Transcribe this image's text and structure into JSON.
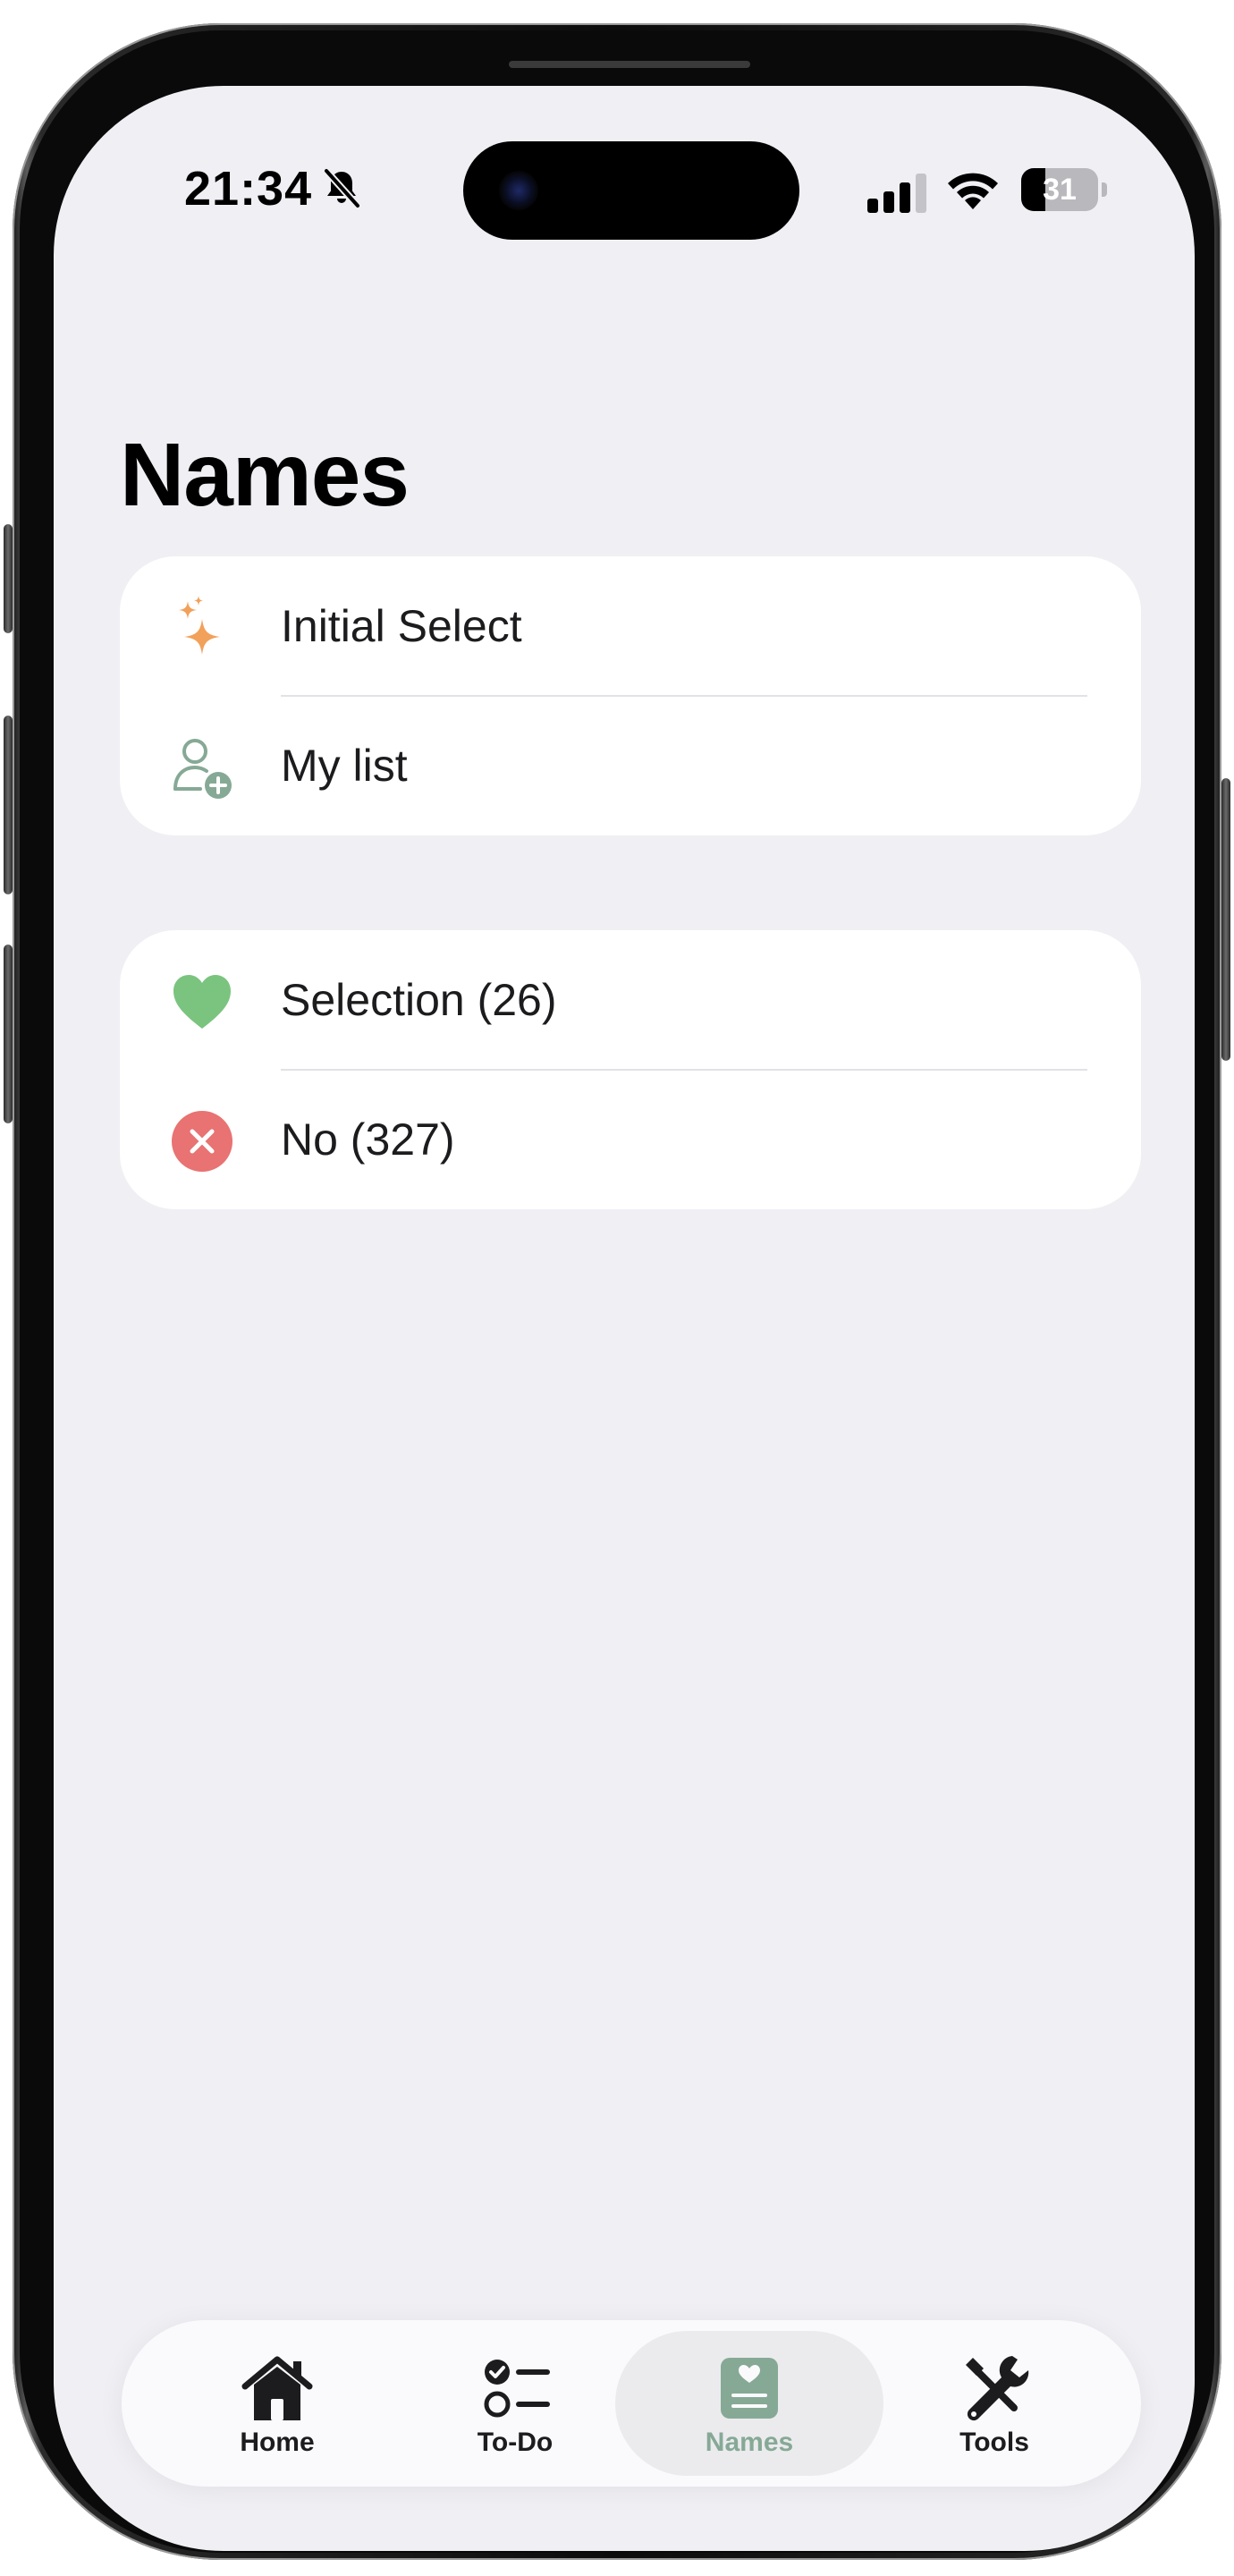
{
  "status_bar": {
    "time": "21:34",
    "battery_level": "31",
    "battery_fraction": 0.31
  },
  "page": {
    "title": "Names"
  },
  "groups": [
    {
      "items": [
        {
          "label": "Initial Select",
          "icon": "sparkles-icon",
          "icon_color": "#f2a15a"
        },
        {
          "label": "My list",
          "icon": "person-add-icon",
          "icon_color": "#86a996"
        }
      ]
    },
    {
      "items": [
        {
          "label": "Selection (26)",
          "icon": "heart-icon",
          "icon_color": "#7bc47f"
        },
        {
          "label": "No (327)",
          "icon": "close-circle-icon",
          "icon_color": "#e97272"
        }
      ]
    }
  ],
  "tabbar": {
    "tabs": [
      {
        "label": "Home",
        "icon": "home-icon"
      },
      {
        "label": "To-Do",
        "icon": "checklist-icon"
      },
      {
        "label": "Names",
        "icon": "names-icon",
        "active": true
      },
      {
        "label": "Tools",
        "icon": "tools-icon"
      }
    ],
    "active_color": "#86a996"
  }
}
